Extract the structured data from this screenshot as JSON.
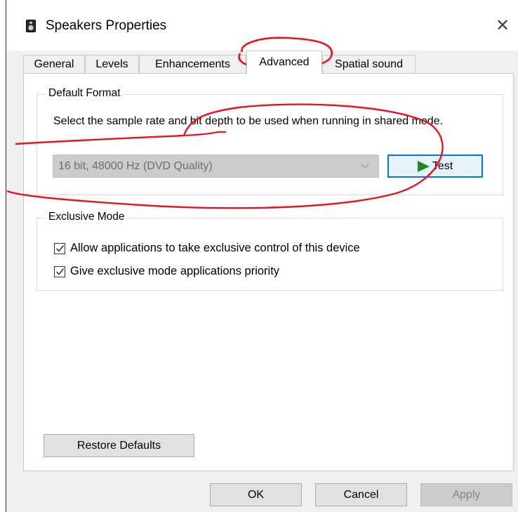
{
  "window": {
    "title": "Speakers Properties",
    "close_glyph": "✕"
  },
  "tabs": [
    {
      "label": "General",
      "active": false
    },
    {
      "label": "Levels",
      "active": false
    },
    {
      "label": "Enhancements",
      "active": false
    },
    {
      "label": "Advanced",
      "active": true
    },
    {
      "label": "Spatial sound",
      "active": false
    }
  ],
  "default_format": {
    "legend": "Default Format",
    "description": "Select the sample rate and bit depth to be used when running in shared mode.",
    "selected": "16 bit, 48000 Hz (DVD Quality)",
    "test_label": "Test"
  },
  "exclusive_mode": {
    "legend": "Exclusive Mode",
    "options": [
      {
        "label": "Allow applications to take exclusive control of this device",
        "checked": true
      },
      {
        "label": "Give exclusive mode applications priority",
        "checked": true
      }
    ]
  },
  "restore_label": "Restore Defaults",
  "footer": {
    "ok": "OK",
    "cancel": "Cancel",
    "apply": "Apply"
  },
  "icons": {
    "title": "speaker-icon",
    "play": "play-icon",
    "dropdown": "chevron-down-icon",
    "check": "checkmark-icon"
  },
  "colors": {
    "accent": "#0078d7",
    "annotation": "#e8141c",
    "play": "#1c8a1c"
  }
}
